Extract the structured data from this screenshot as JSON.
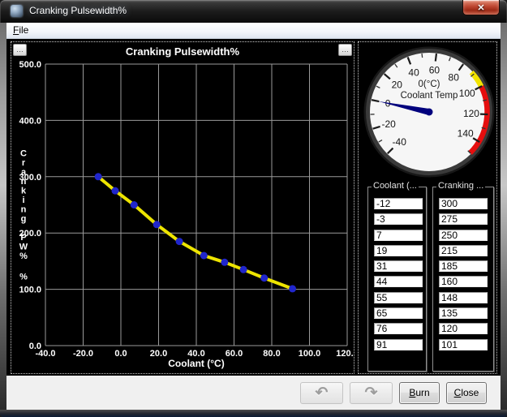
{
  "window": {
    "title": "Cranking Pulsewidth%"
  },
  "menu": {
    "file_label": "File"
  },
  "icons": {
    "close": "✕",
    "undo": "↶",
    "redo": "↷",
    "panel_menu": "…"
  },
  "chart_data": {
    "type": "line",
    "title": "Cranking Pulsewidth%",
    "xlabel": "Coolant (°C)",
    "ylabel": "Cranking PW%",
    "ylabel_unit": "%",
    "x": [
      -12,
      -3,
      7,
      19,
      31,
      44,
      55,
      65,
      76,
      91
    ],
    "y": [
      300,
      275,
      250,
      215,
      185,
      160,
      148,
      135,
      120,
      101
    ],
    "xlim": [
      -40,
      120
    ],
    "ylim": [
      0,
      500
    ],
    "x_ticks": [
      -40,
      -20,
      0,
      20,
      40,
      60,
      80,
      100,
      120
    ],
    "y_ticks": [
      0,
      100,
      200,
      300,
      400,
      500
    ],
    "grid": true,
    "legend": "none",
    "line_color": "#ede400",
    "marker_color": "#2026cc",
    "grid_color": "#9a9a9a",
    "text_color": "#ffffff",
    "bg_color": "#000000"
  },
  "gauge": {
    "title": "Coolant Temp",
    "value_label": "0(°C)",
    "value": 0,
    "min": -40,
    "max": 150,
    "major_ticks": [
      -40,
      -20,
      0,
      20,
      40,
      60,
      80,
      100,
      120,
      140
    ],
    "minor_step": 10,
    "zones": [
      {
        "from": 88,
        "to": 100,
        "color": "#f2e300"
      },
      {
        "from": 100,
        "to": 150,
        "color": "#e50e0e"
      }
    ],
    "needle_color": "#00007d",
    "face_color": "#f6f6f6",
    "ring_color": "#3a3a3a"
  },
  "tables": {
    "coolant": {
      "label": "Coolant (...",
      "values": [
        "-12",
        "-3",
        "7",
        "19",
        "31",
        "44",
        "55",
        "65",
        "76",
        "91"
      ]
    },
    "cranking": {
      "label": "Cranking ...",
      "values": [
        "300",
        "275",
        "250",
        "215",
        "185",
        "160",
        "148",
        "135",
        "120",
        "101"
      ]
    }
  },
  "buttons": {
    "burn": "Burn",
    "close": "Close"
  }
}
